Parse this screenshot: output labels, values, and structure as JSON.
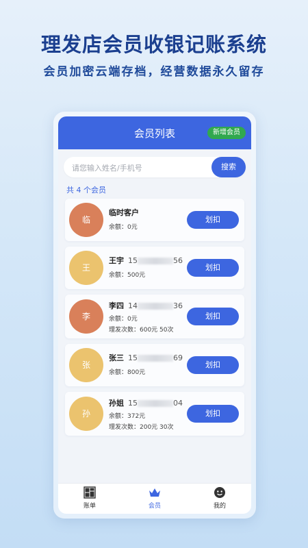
{
  "promo": {
    "title": "理发店会员收银记账系统",
    "subtitle": "会员加密云端存档，经营数据永久留存"
  },
  "header": {
    "title": "会员列表",
    "add_button": "新增会员"
  },
  "search": {
    "placeholder": "请您输入姓名/手机号",
    "button": "搜索"
  },
  "member_count": "共 4 个会员",
  "members": [
    {
      "avatar": "临",
      "name": "临时客户",
      "phone_prefix": "",
      "phone_suffix": "",
      "balance": "余额：0元",
      "times": "",
      "button": "划扣",
      "avatar_color": "#d9805a"
    },
    {
      "avatar": "王",
      "name": "王宇",
      "phone_prefix": "15",
      "phone_suffix": "56",
      "balance": "余额：500元",
      "times": "",
      "button": "划扣",
      "avatar_color": "#ebc36e"
    },
    {
      "avatar": "李",
      "name": "李四",
      "phone_prefix": "14",
      "phone_suffix": "36",
      "balance": "余额：0元",
      "times": "理发次数：600元 50次",
      "button": "划扣",
      "avatar_color": "#d9805a"
    },
    {
      "avatar": "张",
      "name": "张三",
      "phone_prefix": "15",
      "phone_suffix": "69",
      "balance": "余额：800元",
      "times": "",
      "button": "划扣",
      "avatar_color": "#ebc36e"
    },
    {
      "avatar": "孙",
      "name": "孙姐",
      "phone_prefix": "15",
      "phone_suffix": "04",
      "balance": "余额：372元",
      "times": "理发次数：200元 30次",
      "button": "划扣",
      "avatar_color": "#ebc36e"
    }
  ],
  "tabs": [
    {
      "label": "账单",
      "icon": "grid-icon"
    },
    {
      "label": "会员",
      "icon": "crown-icon"
    },
    {
      "label": "我的",
      "icon": "smiley-icon"
    }
  ],
  "colors": {
    "accent": "#3d66e0",
    "add_green": "#31a84e"
  }
}
